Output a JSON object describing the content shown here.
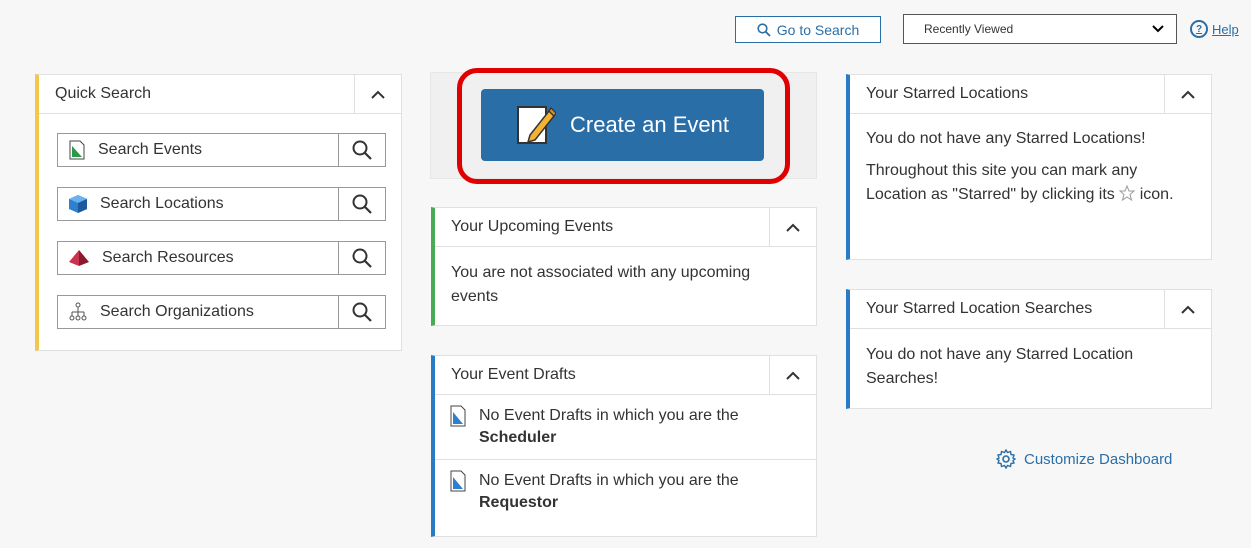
{
  "topbar": {
    "go_to_search_label": "Go to Search",
    "recent_dropdown_value": "Recently Viewed",
    "help_label": "Help"
  },
  "quick_search": {
    "title": "Quick Search",
    "items": [
      {
        "label": "Search Events",
        "icon": "event-document-icon"
      },
      {
        "label": "Search Locations",
        "icon": "location-cube-icon"
      },
      {
        "label": "Search Resources",
        "icon": "resource-pyramid-icon"
      },
      {
        "label": "Search Organizations",
        "icon": "organization-tree-icon"
      }
    ]
  },
  "create_event": {
    "label": "Create an Event"
  },
  "upcoming_events": {
    "title": "Your Upcoming Events",
    "message": "You are not associated with any upcoming events"
  },
  "event_drafts": {
    "title": "Your Event Drafts",
    "items": [
      {
        "text": "No Event Drafts in which you are the",
        "role": "Scheduler"
      },
      {
        "text": "No Event Drafts in which you are the",
        "role": "Requestor"
      }
    ]
  },
  "starred_locations": {
    "title": "Your Starred Locations",
    "message1": "You do not have any Starred Locations!",
    "message2": "Throughout this site you can mark any Location as \"Starred\" by clicking its",
    "message2_suffix": "icon."
  },
  "starred_searches": {
    "title": "Your Starred Location Searches",
    "message": "You do not have any Starred Location Searches!"
  },
  "customize": {
    "label": "Customize Dashboard"
  },
  "colors": {
    "accent": "#2a6ea8",
    "highlight": "#e00000",
    "yellow": "#f3c84a",
    "green": "#4aaa55",
    "blue": "#2a7bc6"
  }
}
